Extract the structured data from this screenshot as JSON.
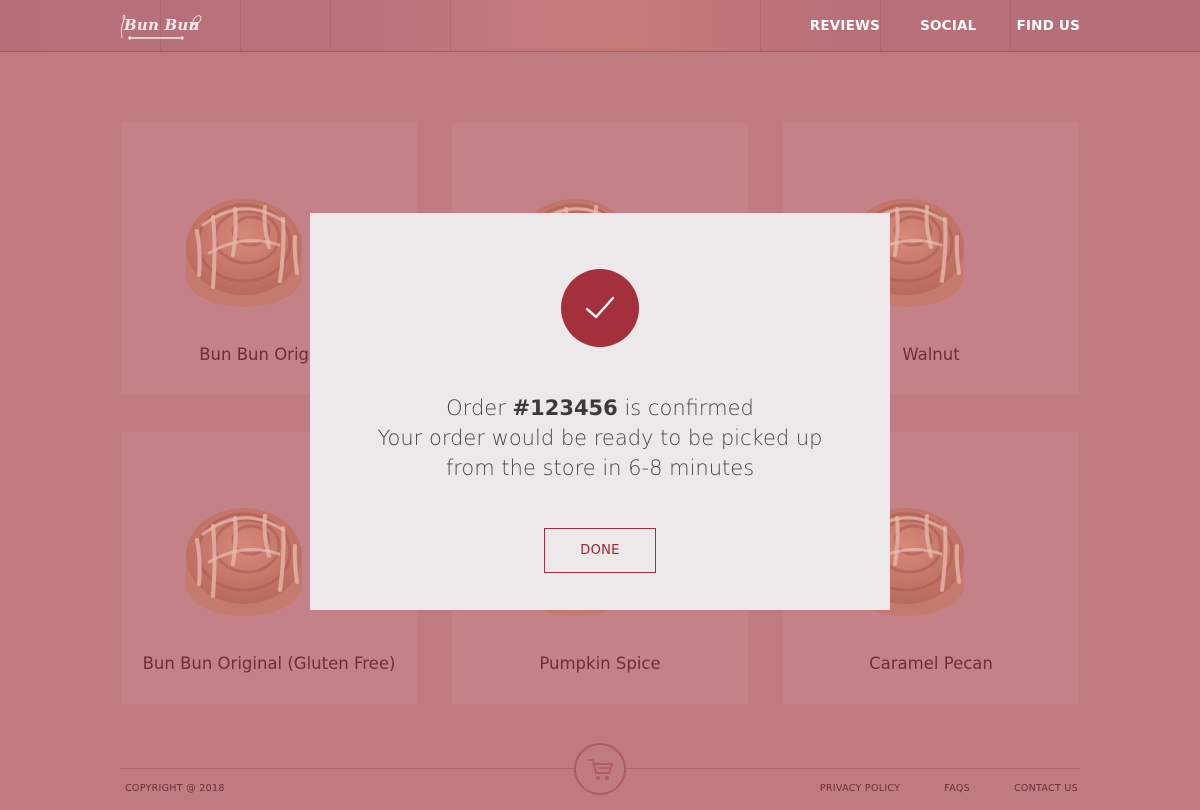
{
  "header": {
    "logo_text": "Bun Bun",
    "nav": [
      "REVIEWS",
      "SOCIAL",
      "FIND US"
    ]
  },
  "products": [
    {
      "name": "Bun Bun Original"
    },
    {
      "name": ""
    },
    {
      "name": "Walnut"
    },
    {
      "name": "Bun Bun Original (Gluten Free)"
    },
    {
      "name": "Pumpkin Spice"
    },
    {
      "name": "Caramel Pecan"
    }
  ],
  "modal": {
    "line1_prefix": "Order ",
    "order_number": "#123456",
    "line1_suffix": " is confirmed",
    "line2": "Your order would be ready to be picked up",
    "line3": "from the store in 6-8 minutes",
    "done_label": "DONE"
  },
  "footer": {
    "copyright": "COPYRIGHT @ 2018",
    "links": [
      "PRIVACY POLICY",
      "FAQS",
      "CONTACT US"
    ]
  },
  "icons": {
    "logo": "logo-whisk-rolling-pin",
    "check": "checkmark-icon",
    "cart": "shopping-cart-icon"
  },
  "colors": {
    "overlay": "#c07b81",
    "accent": "#a4303b",
    "modal_bg": "#ede9ea",
    "text_dark": "#6e2e39"
  }
}
